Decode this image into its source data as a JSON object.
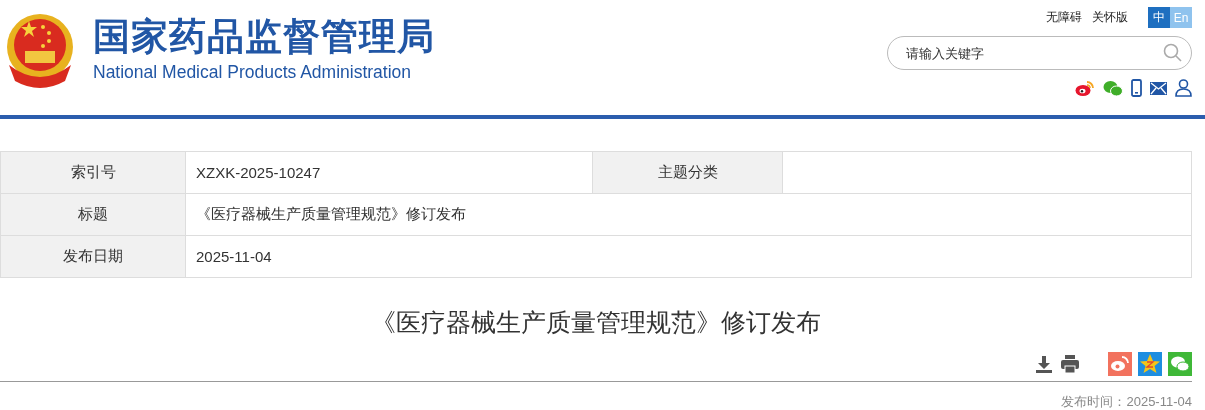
{
  "header": {
    "title_cn": "国家药品监督管理局",
    "title_en": "National Medical Products Administration",
    "links": [
      "无障碍",
      "关怀版"
    ],
    "languages": [
      {
        "label": "中",
        "selected": true
      },
      {
        "label": "En",
        "selected": false
      }
    ],
    "search": {
      "placeholder": "请输入关键字"
    }
  },
  "info_table": {
    "rows": [
      [
        {
          "label": "索引号",
          "value": "XZXK-2025-10247"
        },
        {
          "label": "主题分类"
        }
      ],
      [
        {
          "label": "标题",
          "value": "《医疗器械生产质量管理规范》修订发布"
        }
      ],
      [
        {
          "label": "发布日期",
          "value": "2025-11-04"
        }
      ]
    ]
  },
  "article": {
    "title": "《医疗器械生产质量管理规范》修订发布",
    "publish_label": "发布时间：",
    "publish_date": "2025-11-04"
  }
}
